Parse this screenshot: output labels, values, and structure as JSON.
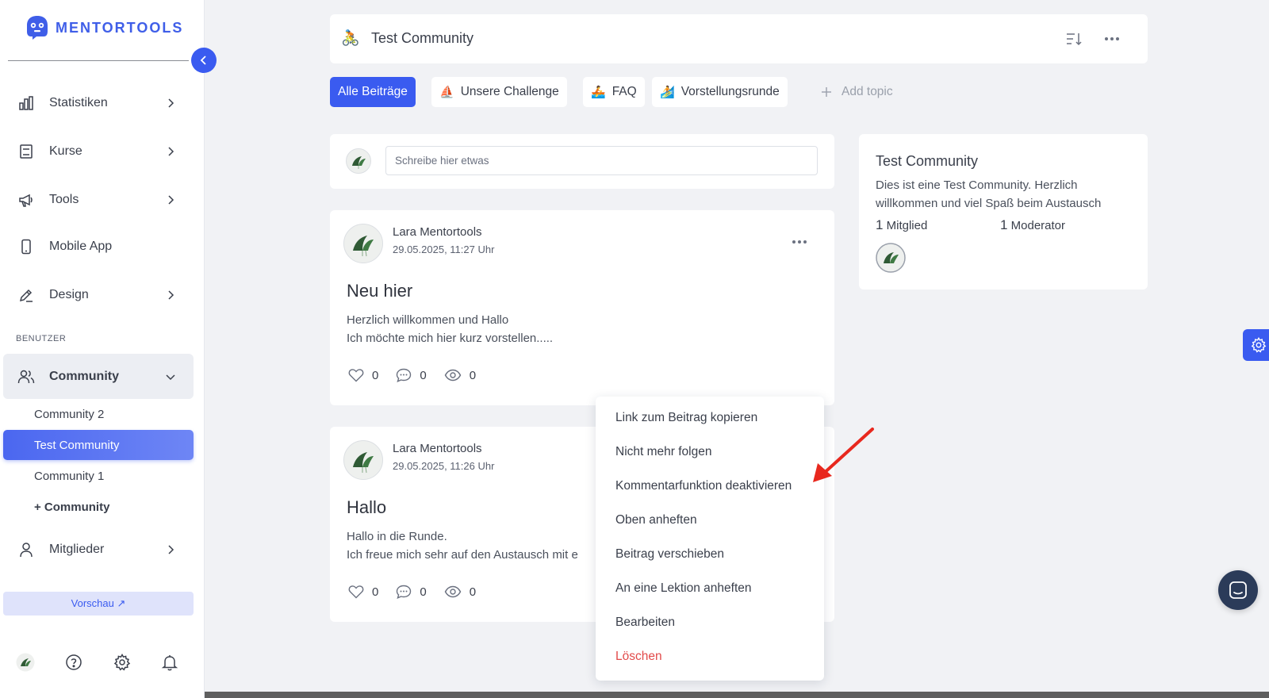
{
  "brand": {
    "name": "MENTORTOOLS",
    "color": "#3f5ee8"
  },
  "sidebar": {
    "nav": [
      {
        "label": "Statistiken",
        "icon": "bar-chart-icon"
      },
      {
        "label": "Kurse",
        "icon": "book-icon"
      },
      {
        "label": "Tools",
        "icon": "megaphone-icon"
      },
      {
        "label": "Mobile App",
        "icon": "smartphone-icon"
      },
      {
        "label": "Design",
        "icon": "pencil-icon"
      }
    ],
    "section_label": "BENUTZER",
    "community": {
      "label": "Community",
      "icon": "users-icon"
    },
    "communities": [
      "Community 2",
      "Test Community",
      "Community 1"
    ],
    "add_community": "+ Community",
    "members": {
      "label": "Mitglieder",
      "icon": "user-icon"
    },
    "preview": "Vorschau ↗"
  },
  "header": {
    "emoji": "🚴",
    "title": "Test Community"
  },
  "topics": [
    {
      "label": "Alle Beiträge",
      "emoji": "",
      "active": true
    },
    {
      "label": "Unsere Challenge",
      "emoji": "⛵"
    },
    {
      "label": "FAQ",
      "emoji": "🚣"
    },
    {
      "label": "Vorstellungsrunde",
      "emoji": "🏄"
    },
    {
      "label": "Add topic",
      "emoji": ""
    }
  ],
  "composer": {
    "placeholder": "Schreibe hier etwas"
  },
  "posts": [
    {
      "author": "Lara Mentortools",
      "date": "29.05.2025, 11:27 Uhr",
      "title": "Neu hier",
      "body": [
        "Herzlich willkommen und Hallo",
        "Ich möchte mich hier kurz vorstellen....."
      ],
      "likes": "0",
      "comments": "0",
      "views": "0"
    },
    {
      "author": "Lara Mentortools",
      "date": "29.05.2025, 11:26 Uhr",
      "title": "Hallo",
      "body": [
        "Hallo in die Runde.",
        "Ich freue mich sehr auf den Austausch mit e"
      ],
      "likes": "0",
      "comments": "0",
      "views": "0"
    }
  ],
  "info": {
    "title": "Test Community",
    "description": "Dies ist eine Test Community. Herzlich willkommen und viel Spaß beim Austausch",
    "members_count": "1",
    "members_label": "Mitglied",
    "moderators_count": "1",
    "moderators_label": "Moderator"
  },
  "context_menu": [
    "Link zum Beitrag kopieren",
    "Nicht mehr folgen",
    "Kommentarfunktion deaktivieren",
    "Oben anheften",
    "Beitrag verschieben",
    "An eine Lektion anheften",
    "Bearbeiten",
    "Löschen"
  ],
  "colors": {
    "accent": "#3a5bf0",
    "danger": "#e24a4a",
    "annotation_arrow": "#e8281e"
  }
}
